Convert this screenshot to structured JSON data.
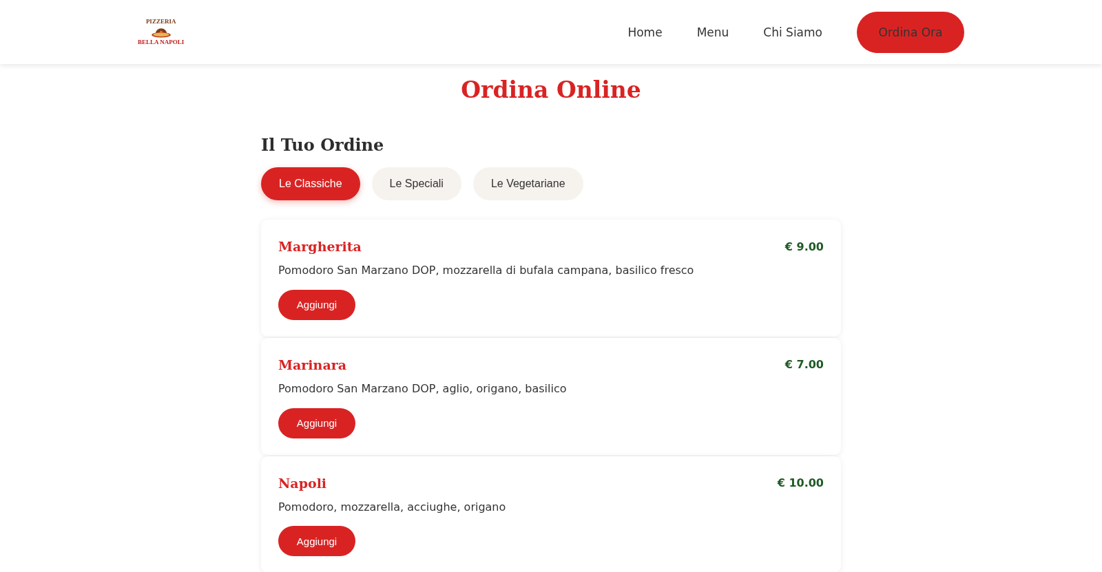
{
  "header": {
    "logo": {
      "top_text": "PIZZERIA",
      "bottom_text": "BELLA NAPOLI"
    },
    "nav": [
      "Home",
      "Menu",
      "Chi Siamo"
    ],
    "cta": "Ordina Ora"
  },
  "title": "Ordina Online",
  "order": {
    "heading": "Il Tuo Ordine",
    "tabs": [
      {
        "label": "Le Classiche",
        "selected": true
      },
      {
        "label": "Le Speciali",
        "selected": false
      },
      {
        "label": "Le Vegetariane",
        "selected": false
      }
    ],
    "items": [
      {
        "name": "Margherita",
        "price": "€ 9.00",
        "description": "Pomodoro San Marzano DOP, mozzarella di bufala campana, basilico fresco",
        "button": "Aggiungi"
      },
      {
        "name": "Marinara",
        "price": "€ 7.00",
        "description": "Pomodoro San Marzano DOP, aglio, origano, basilico",
        "button": "Aggiungi"
      },
      {
        "name": "Napoli",
        "price": "€ 10.00",
        "description": "Pomodoro, mozzarella, acciughe, origano",
        "button": "Aggiungi"
      }
    ]
  }
}
